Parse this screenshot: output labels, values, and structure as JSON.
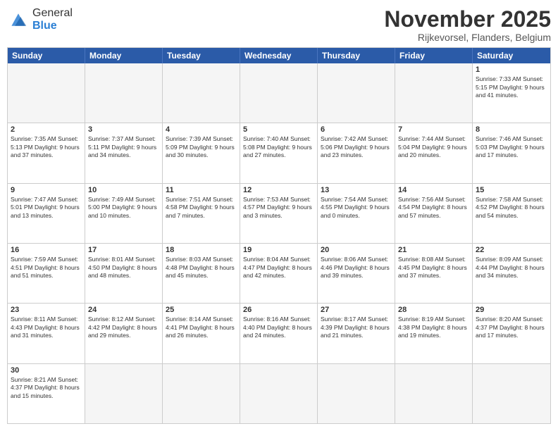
{
  "logo": {
    "text_general": "General",
    "text_blue": "Blue"
  },
  "header": {
    "month": "November 2025",
    "location": "Rijkevorsel, Flanders, Belgium"
  },
  "day_headers": [
    "Sunday",
    "Monday",
    "Tuesday",
    "Wednesday",
    "Thursday",
    "Friday",
    "Saturday"
  ],
  "weeks": [
    [
      {
        "day": "",
        "info": "",
        "empty": true
      },
      {
        "day": "",
        "info": "",
        "empty": true
      },
      {
        "day": "",
        "info": "",
        "empty": true
      },
      {
        "day": "",
        "info": "",
        "empty": true
      },
      {
        "day": "",
        "info": "",
        "empty": true
      },
      {
        "day": "",
        "info": "",
        "empty": true
      },
      {
        "day": "1",
        "info": "Sunrise: 7:33 AM\nSunset: 5:15 PM\nDaylight: 9 hours and 41 minutes.",
        "empty": false
      }
    ],
    [
      {
        "day": "2",
        "info": "Sunrise: 7:35 AM\nSunset: 5:13 PM\nDaylight: 9 hours and 37 minutes.",
        "empty": false
      },
      {
        "day": "3",
        "info": "Sunrise: 7:37 AM\nSunset: 5:11 PM\nDaylight: 9 hours and 34 minutes.",
        "empty": false
      },
      {
        "day": "4",
        "info": "Sunrise: 7:39 AM\nSunset: 5:09 PM\nDaylight: 9 hours and 30 minutes.",
        "empty": false
      },
      {
        "day": "5",
        "info": "Sunrise: 7:40 AM\nSunset: 5:08 PM\nDaylight: 9 hours and 27 minutes.",
        "empty": false
      },
      {
        "day": "6",
        "info": "Sunrise: 7:42 AM\nSunset: 5:06 PM\nDaylight: 9 hours and 23 minutes.",
        "empty": false
      },
      {
        "day": "7",
        "info": "Sunrise: 7:44 AM\nSunset: 5:04 PM\nDaylight: 9 hours and 20 minutes.",
        "empty": false
      },
      {
        "day": "8",
        "info": "Sunrise: 7:46 AM\nSunset: 5:03 PM\nDaylight: 9 hours and 17 minutes.",
        "empty": false
      }
    ],
    [
      {
        "day": "9",
        "info": "Sunrise: 7:47 AM\nSunset: 5:01 PM\nDaylight: 9 hours and 13 minutes.",
        "empty": false
      },
      {
        "day": "10",
        "info": "Sunrise: 7:49 AM\nSunset: 5:00 PM\nDaylight: 9 hours and 10 minutes.",
        "empty": false
      },
      {
        "day": "11",
        "info": "Sunrise: 7:51 AM\nSunset: 4:58 PM\nDaylight: 9 hours and 7 minutes.",
        "empty": false
      },
      {
        "day": "12",
        "info": "Sunrise: 7:53 AM\nSunset: 4:57 PM\nDaylight: 9 hours and 3 minutes.",
        "empty": false
      },
      {
        "day": "13",
        "info": "Sunrise: 7:54 AM\nSunset: 4:55 PM\nDaylight: 9 hours and 0 minutes.",
        "empty": false
      },
      {
        "day": "14",
        "info": "Sunrise: 7:56 AM\nSunset: 4:54 PM\nDaylight: 8 hours and 57 minutes.",
        "empty": false
      },
      {
        "day": "15",
        "info": "Sunrise: 7:58 AM\nSunset: 4:52 PM\nDaylight: 8 hours and 54 minutes.",
        "empty": false
      }
    ],
    [
      {
        "day": "16",
        "info": "Sunrise: 7:59 AM\nSunset: 4:51 PM\nDaylight: 8 hours and 51 minutes.",
        "empty": false
      },
      {
        "day": "17",
        "info": "Sunrise: 8:01 AM\nSunset: 4:50 PM\nDaylight: 8 hours and 48 minutes.",
        "empty": false
      },
      {
        "day": "18",
        "info": "Sunrise: 8:03 AM\nSunset: 4:48 PM\nDaylight: 8 hours and 45 minutes.",
        "empty": false
      },
      {
        "day": "19",
        "info": "Sunrise: 8:04 AM\nSunset: 4:47 PM\nDaylight: 8 hours and 42 minutes.",
        "empty": false
      },
      {
        "day": "20",
        "info": "Sunrise: 8:06 AM\nSunset: 4:46 PM\nDaylight: 8 hours and 39 minutes.",
        "empty": false
      },
      {
        "day": "21",
        "info": "Sunrise: 8:08 AM\nSunset: 4:45 PM\nDaylight: 8 hours and 37 minutes.",
        "empty": false
      },
      {
        "day": "22",
        "info": "Sunrise: 8:09 AM\nSunset: 4:44 PM\nDaylight: 8 hours and 34 minutes.",
        "empty": false
      }
    ],
    [
      {
        "day": "23",
        "info": "Sunrise: 8:11 AM\nSunset: 4:43 PM\nDaylight: 8 hours and 31 minutes.",
        "empty": false
      },
      {
        "day": "24",
        "info": "Sunrise: 8:12 AM\nSunset: 4:42 PM\nDaylight: 8 hours and 29 minutes.",
        "empty": false
      },
      {
        "day": "25",
        "info": "Sunrise: 8:14 AM\nSunset: 4:41 PM\nDaylight: 8 hours and 26 minutes.",
        "empty": false
      },
      {
        "day": "26",
        "info": "Sunrise: 8:16 AM\nSunset: 4:40 PM\nDaylight: 8 hours and 24 minutes.",
        "empty": false
      },
      {
        "day": "27",
        "info": "Sunrise: 8:17 AM\nSunset: 4:39 PM\nDaylight: 8 hours and 21 minutes.",
        "empty": false
      },
      {
        "day": "28",
        "info": "Sunrise: 8:19 AM\nSunset: 4:38 PM\nDaylight: 8 hours and 19 minutes.",
        "empty": false
      },
      {
        "day": "29",
        "info": "Sunrise: 8:20 AM\nSunset: 4:37 PM\nDaylight: 8 hours and 17 minutes.",
        "empty": false
      }
    ],
    [
      {
        "day": "30",
        "info": "Sunrise: 8:21 AM\nSunset: 4:37 PM\nDaylight: 8 hours and 15 minutes.",
        "empty": false
      },
      {
        "day": "",
        "info": "",
        "empty": true
      },
      {
        "day": "",
        "info": "",
        "empty": true
      },
      {
        "day": "",
        "info": "",
        "empty": true
      },
      {
        "day": "",
        "info": "",
        "empty": true
      },
      {
        "day": "",
        "info": "",
        "empty": true
      },
      {
        "day": "",
        "info": "",
        "empty": true
      }
    ]
  ]
}
